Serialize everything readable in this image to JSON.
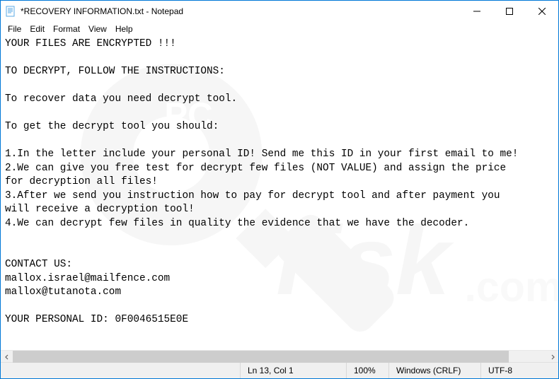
{
  "window": {
    "title": "*RECOVERY INFORMATION.txt - Notepad"
  },
  "menu": {
    "file": "File",
    "edit": "Edit",
    "format": "Format",
    "view": "View",
    "help": "Help"
  },
  "document": {
    "text": "YOUR FILES ARE ENCRYPTED !!!\n\nTO DECRYPT, FOLLOW THE INSTRUCTIONS:\n\nTo recover data you need decrypt tool.\n\nTo get the decrypt tool you should:\n\n1.In the letter include your personal ID! Send me this ID in your first email to me!\n2.We can give you free test for decrypt few files (NOT VALUE) and assign the price\nfor decryption all files!\n3.After we send you instruction how to pay for decrypt tool and after payment you\nwill receive a decryption tool!\n4.We can decrypt few files in quality the evidence that we have the decoder.\n\n\nCONTACT US:\nmallox.israel@mailfence.com\nmallox@tutanota.com\n\nYOUR PERSONAL ID: 0F0046515E0E"
  },
  "status": {
    "position": "Ln 13, Col 1",
    "zoom": "100%",
    "line_ending": "Windows (CRLF)",
    "encoding": "UTF-8"
  }
}
